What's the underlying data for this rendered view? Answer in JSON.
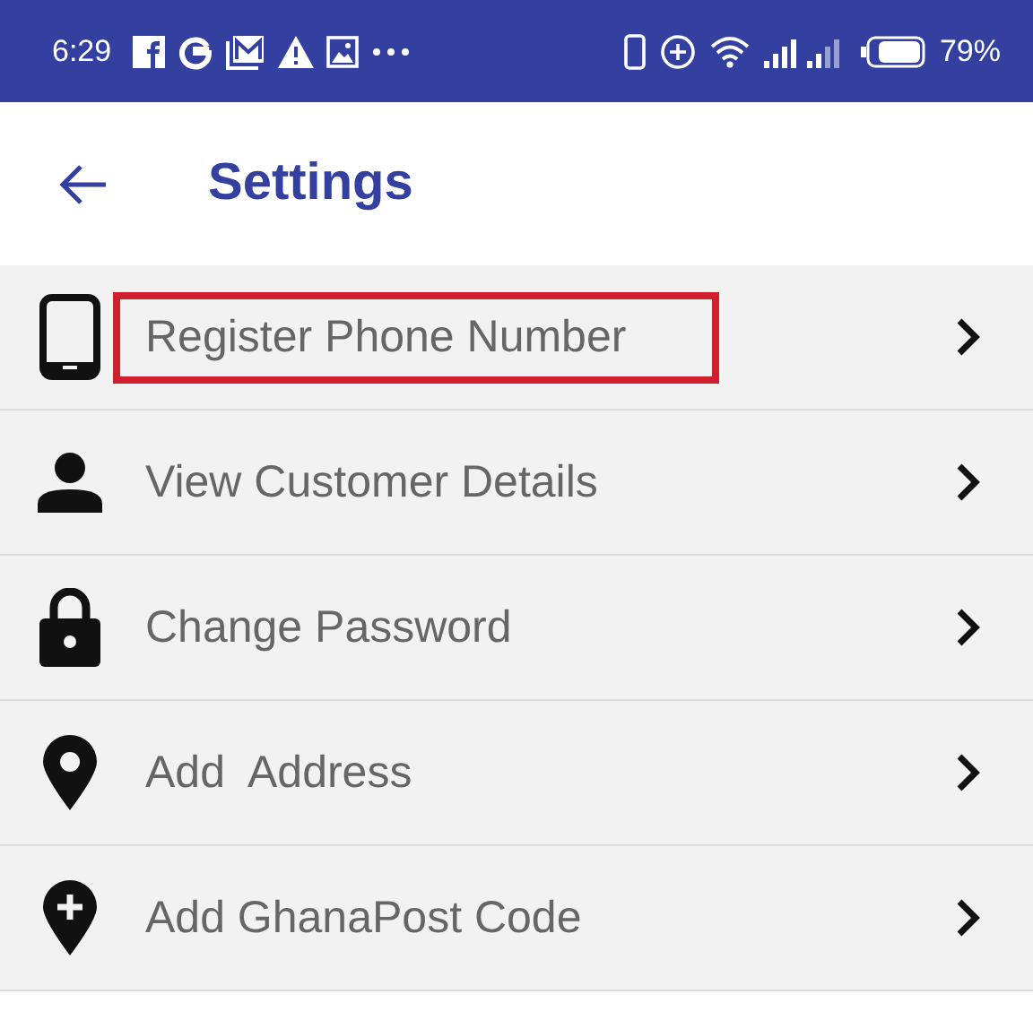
{
  "status_bar": {
    "time": "6:29",
    "battery": "79%"
  },
  "app_bar": {
    "title": "Settings"
  },
  "items": [
    {
      "label": "Register Phone Number",
      "kind": "phone",
      "highlighted": true
    },
    {
      "label": "View Customer Details",
      "kind": "person",
      "highlighted": false
    },
    {
      "label": "Change Password",
      "kind": "lock",
      "highlighted": false
    },
    {
      "label": "Add  Address",
      "kind": "pin",
      "highlighted": false
    },
    {
      "label": "Add GhanaPost Code",
      "kind": "pin-plus",
      "highlighted": false
    }
  ]
}
